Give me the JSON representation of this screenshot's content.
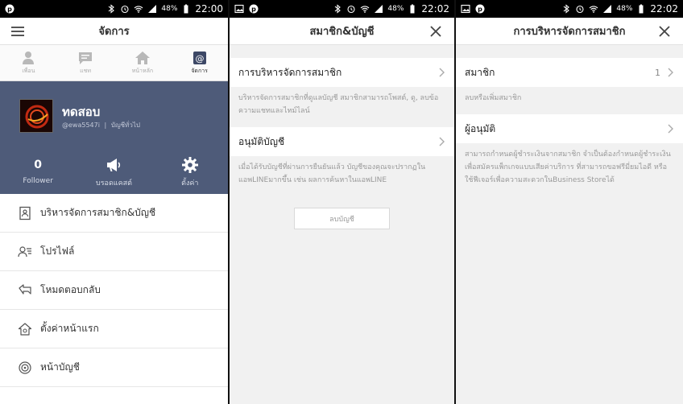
{
  "status1": {
    "battery": "48%",
    "time": "22:00"
  },
  "status2": {
    "battery": "48%",
    "time": "22:02"
  },
  "status3": {
    "battery": "48%",
    "time": "22:02"
  },
  "screen1": {
    "title": "จัดการ",
    "tabs": [
      {
        "label": "เพื่อน",
        "icon": "person-icon"
      },
      {
        "label": "แชท",
        "icon": "chat-icon"
      },
      {
        "label": "หน้าหลัก",
        "icon": "home-icon"
      },
      {
        "label": "จัดการ",
        "icon": "at-sign-icon"
      }
    ],
    "profile": {
      "name": "ทดสอบ",
      "id": "@ewa5547i",
      "type": "บัญชีทั่วไป"
    },
    "stats": {
      "follower_count": "0",
      "follower_label": "Follower",
      "broadcast_label": "บรอดแคสต์",
      "settings_label": "ตั้งค่า"
    },
    "menu": [
      {
        "label": "บริหารจัดการสมาชิก&บัญชี",
        "icon": "contact-book-icon"
      },
      {
        "label": "โปรไฟล์",
        "icon": "profile-card-icon"
      },
      {
        "label": "โหมดตอบกลับ",
        "icon": "reply-icon"
      },
      {
        "label": "ตั้งค่าหน้าแรก",
        "icon": "home-settings-icon"
      },
      {
        "label": "หน้าบัญชี",
        "icon": "account-page-icon"
      }
    ]
  },
  "screen2": {
    "title": "สมาชิก&บัญชี",
    "row1_label": "การบริหารจัดการสมาชิก",
    "row1_desc": "บริหารจัดการสมาชิกที่ดูแลบัญชี สมาชิกสามารถโพสต์, ดู, ลบข้อความแชทและไทม์ไลน์",
    "row2_label": "อนุมัติบัญชี",
    "row2_desc": "เมื่อได้รับบัญชีที่ผ่านการยืนยันแล้ว บัญชีของคุณจะปรากฏในแอพLINEมากขึ้น เช่น ผลการค้นหาในแอพLINE",
    "delete_button": "ลบบัญชี"
  },
  "screen3": {
    "title": "การบริหารจัดการสมาชิก",
    "row1_label": "สมาชิก",
    "row1_value": "1",
    "row1_desc": "ลบหรือเพิ่มสมาชิก",
    "row2_label": "ผู้อนุมัติ",
    "row2_desc": "สามารถกำหนดผู้ชำระเงินจากสมาชิก จำเป็นต้องกำหนดผู้ชำระเงิน เพื่อสมัครแพ็กเกจแบบเสียค่าบริการ ที่สามารถขอฟรีมี่ยมไอดี หรือใช้ฟีเจอร์เพื่อความสะดวกในBusiness Storeได้"
  },
  "colors": {
    "profile_bg": "#4e5b79",
    "status_bg": "#000000"
  }
}
